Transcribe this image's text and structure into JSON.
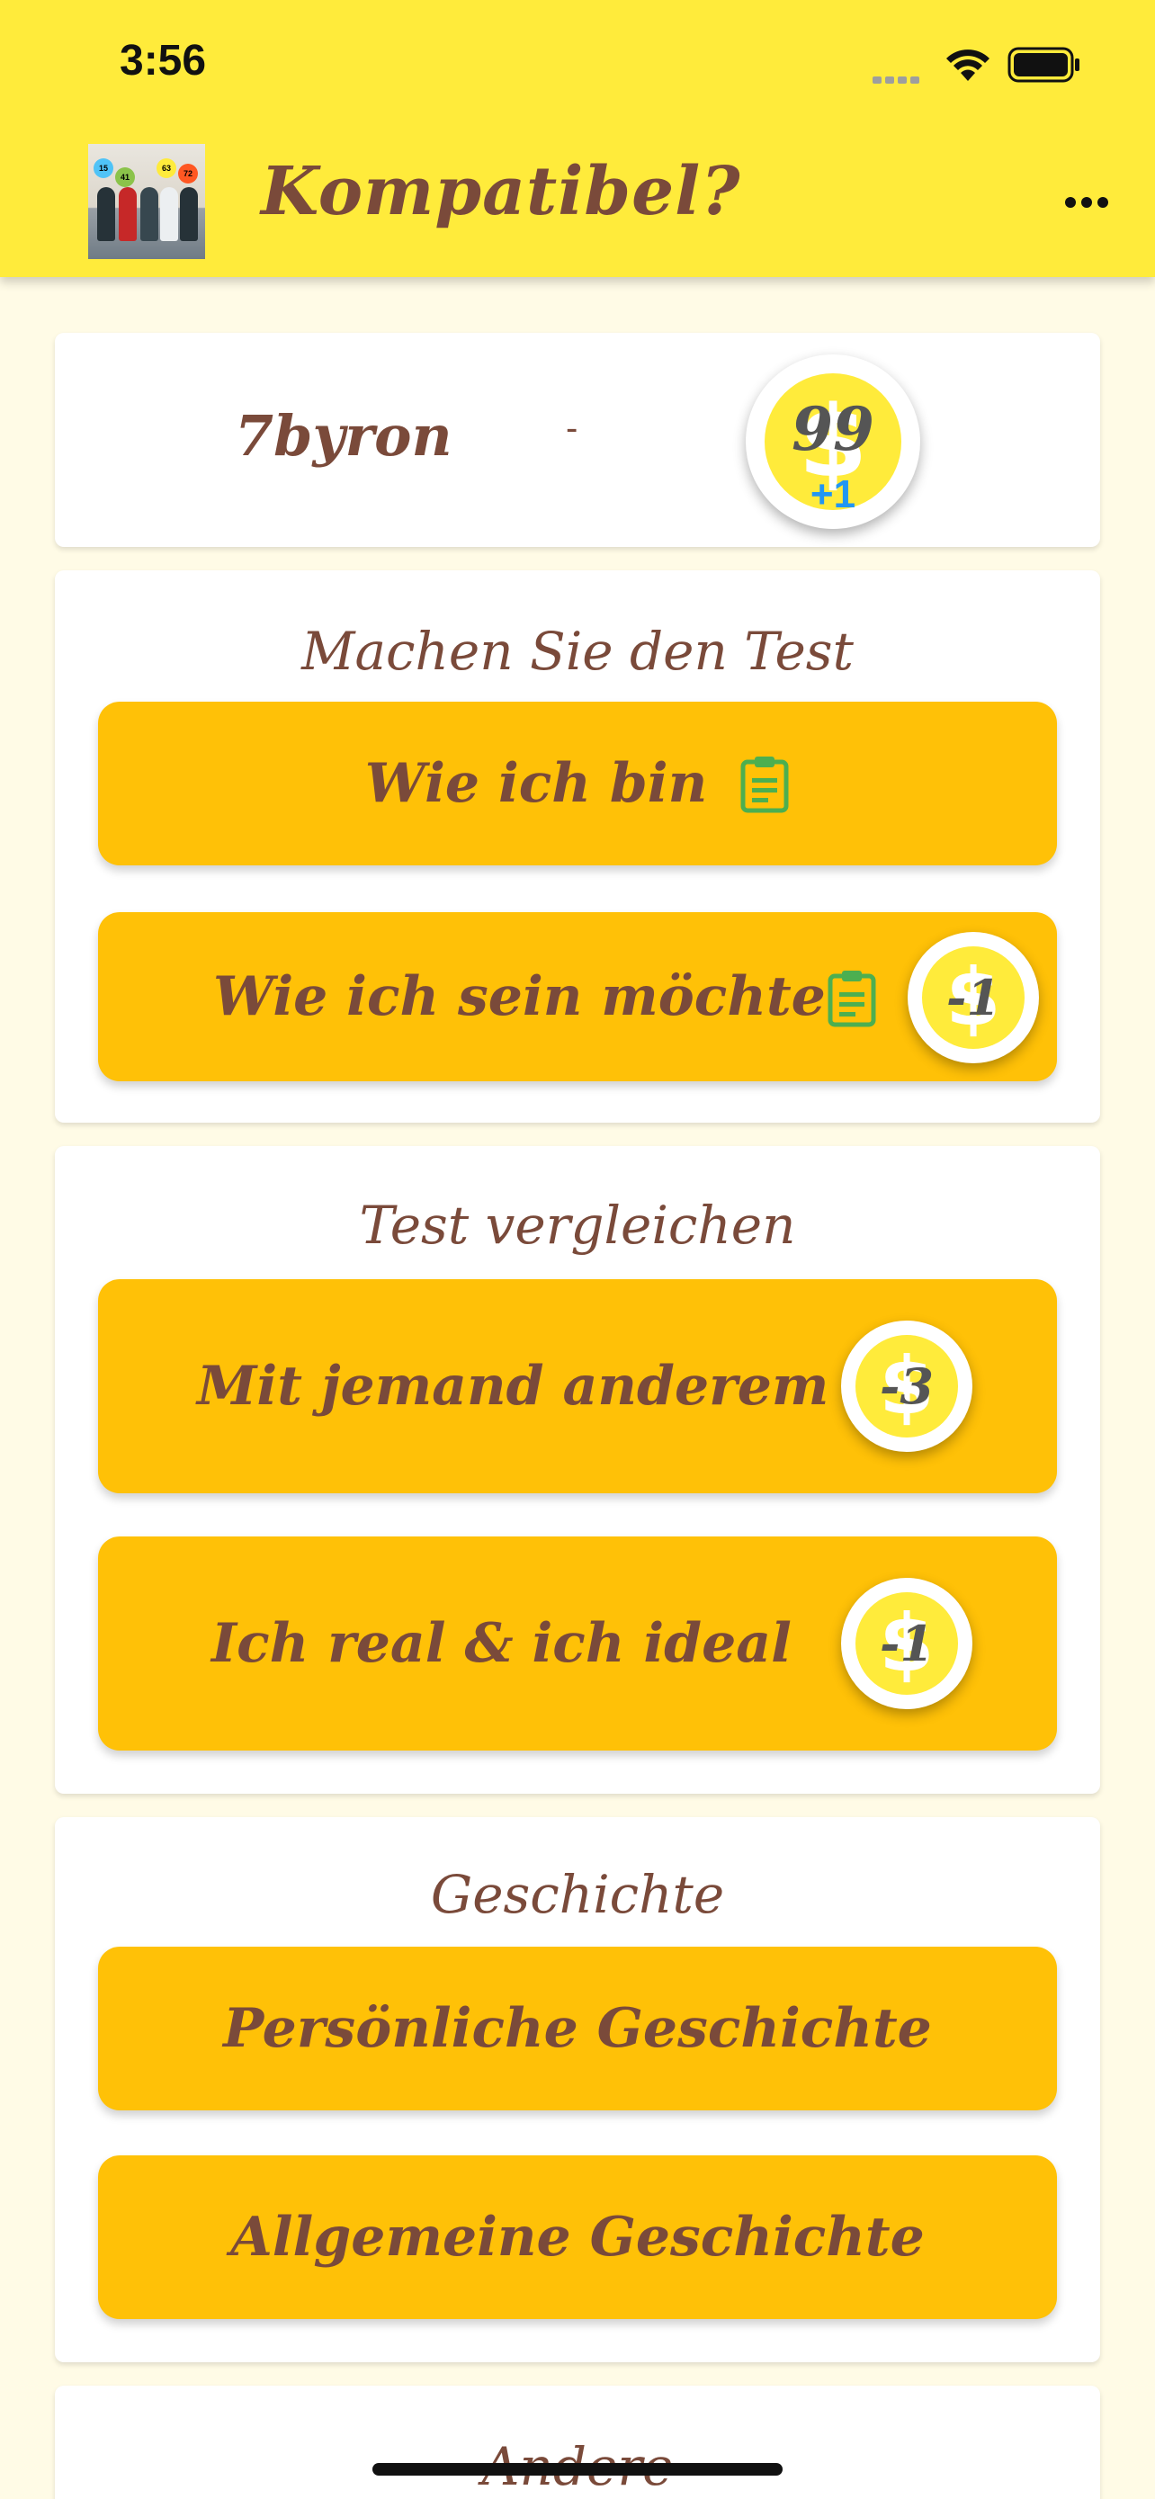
{
  "status_bar": {
    "time": "3:56"
  },
  "header": {
    "title": "Kompatibel?",
    "avatar_balls": [
      "15",
      "41",
      "63",
      "72"
    ]
  },
  "profile": {
    "username": "7byron",
    "separator": "-",
    "coins": "99",
    "bonus": "+1"
  },
  "section_test": {
    "title": "Machen Sie den Test",
    "buttons": [
      {
        "label": "Wie ich bin",
        "icon": "clipboard-icon"
      },
      {
        "label": "Wie ich sein möchte",
        "icon": "clipboard-icon",
        "cost": "-1"
      }
    ]
  },
  "section_compare": {
    "title": "Test vergleichen",
    "buttons": [
      {
        "label": "Mit jemand anderem",
        "cost": "-3"
      },
      {
        "label": "Ich real & ich ideal",
        "cost": "-1"
      }
    ]
  },
  "section_history": {
    "title": "Geschichte",
    "buttons": [
      {
        "label": "Persönliche Geschichte"
      },
      {
        "label": "Allgemeine Geschichte"
      }
    ]
  },
  "section_other": {
    "title": "Andere"
  },
  "colors": {
    "header_bg": "#FFEB3B",
    "page_bg": "#FFFBE6",
    "button_bg": "#FFC107",
    "text_brown": "#7A4A3A",
    "coin_yellow": "#FFEB3B",
    "clipboard_green": "#4CAF50",
    "bonus_blue": "#2196F3"
  }
}
